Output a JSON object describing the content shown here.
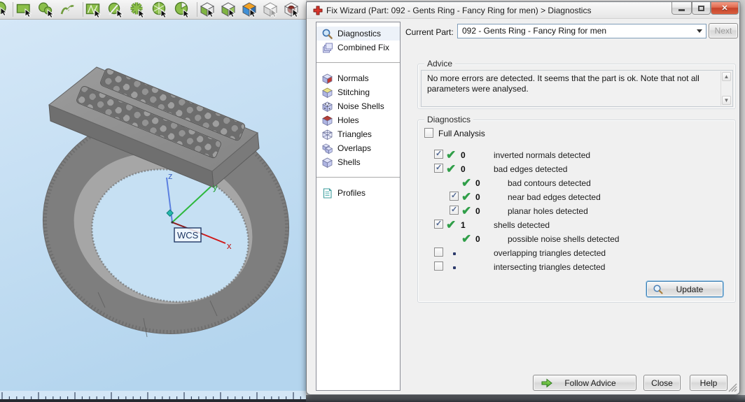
{
  "window": {
    "title": "Fix Wizard (Part: 092 - Gents Ring - Fancy Ring for men) > Diagnostics"
  },
  "toolbar": {
    "tools": [
      "marked-tool-partial",
      "mark-rectangle",
      "mark-ellipse",
      "mark-freeform",
      "mark-window-triangles",
      "mark-brush",
      "mark-star",
      "mark-circle",
      "mark-sector",
      "mark-plane-cube",
      "mark-surface-cube",
      "mark-shell-cube",
      "unmark-cube",
      "mark-point-sphere-cube"
    ]
  },
  "viewport": {
    "wcs_label": "WCS",
    "axes": {
      "x": "x",
      "y": "y",
      "z": "z"
    }
  },
  "dialog": {
    "current_part": {
      "label": "Current Part:",
      "value": "092 - Gents Ring - Fancy Ring for men",
      "next_label": "Next"
    },
    "sidebar": {
      "items": [
        {
          "label": "Diagnostics",
          "icon": "magnifier-icon",
          "selected": true
        },
        {
          "label": "Combined Fix",
          "icon": "layers-icon",
          "selected": false
        },
        {
          "label": "Normals",
          "icon": "cube-red-face-icon",
          "selected": false
        },
        {
          "label": "Stitching",
          "icon": "cube-yellow-top-icon",
          "selected": false
        },
        {
          "label": "Noise Shells",
          "icon": "cube-speckled-icon",
          "selected": false
        },
        {
          "label": "Holes",
          "icon": "cube-red-top-icon",
          "selected": false
        },
        {
          "label": "Triangles",
          "icon": "cube-wireframe-icon",
          "selected": false
        },
        {
          "label": "Overlaps",
          "icon": "cubes-overlapping-icon",
          "selected": false
        },
        {
          "label": "Shells",
          "icon": "cube-plain-icon",
          "selected": false
        },
        {
          "label": "Profiles",
          "icon": "document-icon",
          "selected": false
        }
      ]
    },
    "advice": {
      "group_label": "Advice",
      "text": "No more errors are detected. It seems that the part is ok. Note that not all parameters were analysed."
    },
    "diagnostics": {
      "group_label": "Diagnostics",
      "full_analysis_label": "Full Analysis",
      "rows": [
        {
          "checkbox": "checked",
          "status": "ok",
          "count": "0",
          "label": "inverted normals detected",
          "indent": 0
        },
        {
          "checkbox": "checked",
          "status": "ok",
          "count": "0",
          "label": "bad edges detected",
          "indent": 0
        },
        {
          "checkbox": "none",
          "status": "ok",
          "count": "0",
          "label": "bad contours detected",
          "indent": 1
        },
        {
          "checkbox": "checked",
          "status": "ok",
          "count": "0",
          "label": "near bad edges detected",
          "indent": 1
        },
        {
          "checkbox": "checked",
          "status": "ok",
          "count": "0",
          "label": "planar holes detected",
          "indent": 1
        },
        {
          "checkbox": "checked",
          "status": "ok",
          "count": "1",
          "label": "shells detected",
          "indent": 0
        },
        {
          "checkbox": "none",
          "status": "ok",
          "count": "0",
          "label": "possible noise shells detected",
          "indent": 1
        },
        {
          "checkbox": "unchecked",
          "status": "idle",
          "count": "",
          "label": "overlapping triangles detected",
          "indent": 0
        },
        {
          "checkbox": "unchecked",
          "status": "idle",
          "count": "",
          "label": "intersecting triangles detected",
          "indent": 0
        }
      ],
      "update_label": "Update"
    },
    "footer": {
      "follow_advice_label": "Follow Advice",
      "close_label": "Close",
      "help_label": "Help"
    }
  },
  "colors": {
    "ok_green": "#2f9e48",
    "toolbar_green": "#8cbf4a",
    "viewport_bg": "#c3def2",
    "close_red": "#c6432b",
    "axis_x": "#c01515",
    "axis_y": "#21a02e",
    "axis_z": "#4169c8"
  }
}
